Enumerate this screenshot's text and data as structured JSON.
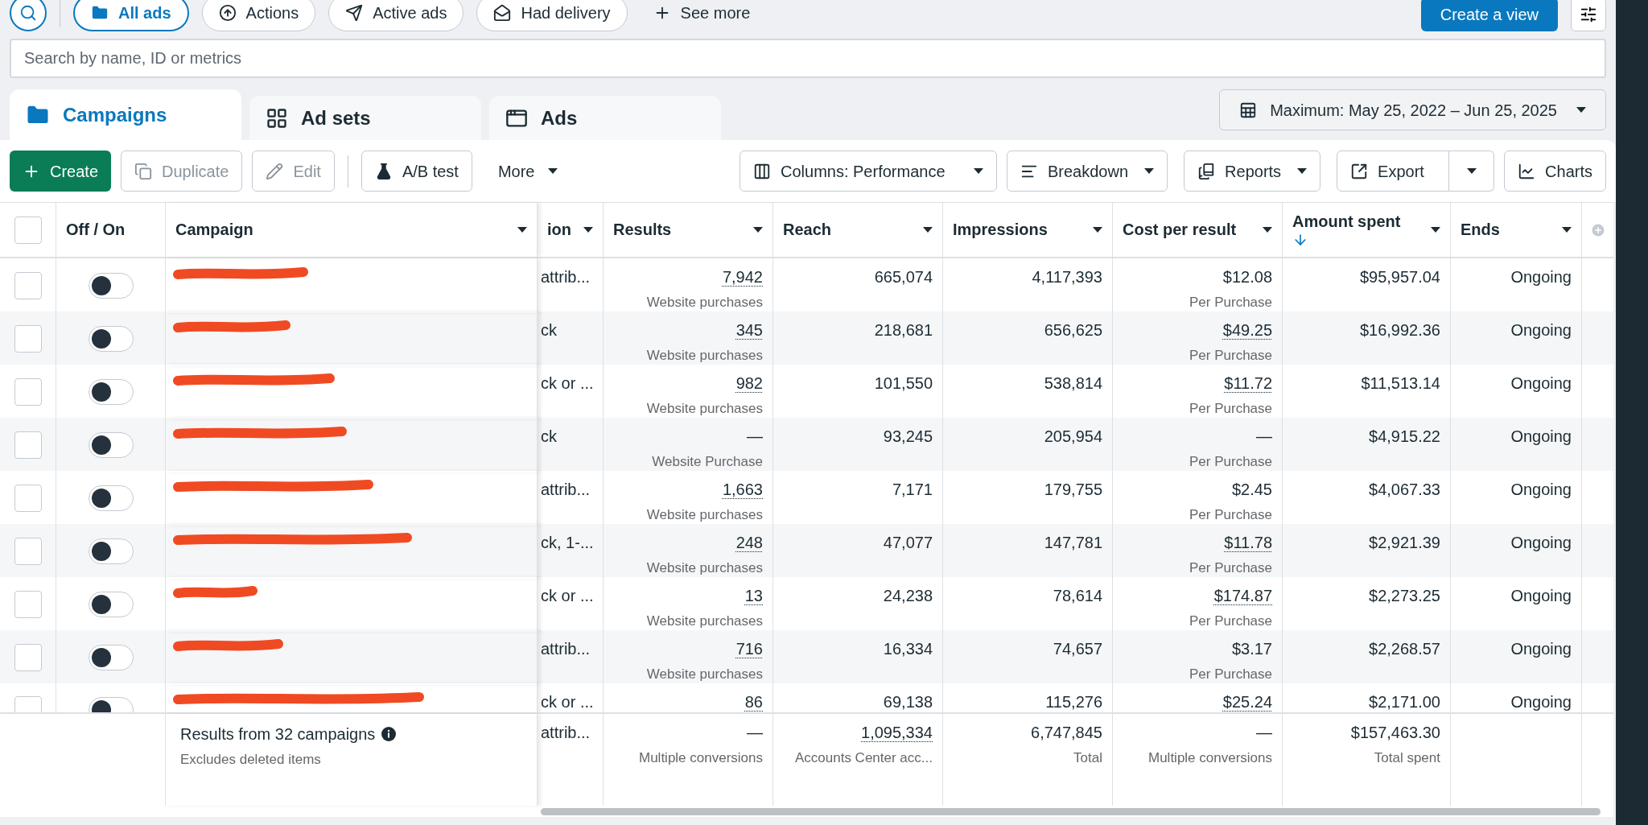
{
  "filters": [
    {
      "label": "All ads",
      "selected": true,
      "kind": "folder"
    },
    {
      "label": "Actions",
      "selected": false,
      "kind": "actions"
    },
    {
      "label": "Active ads",
      "selected": false,
      "kind": "send"
    },
    {
      "label": "Had delivery",
      "selected": false,
      "kind": "mail"
    }
  ],
  "see_more": "See more",
  "create_view": "Create a view",
  "search": {
    "placeholder": "Search by name, ID or metrics"
  },
  "tabs": [
    {
      "label": "Campaigns",
      "selected": true,
      "kind": "campaigns"
    },
    {
      "label": "Ad sets",
      "selected": false,
      "kind": "adsets"
    },
    {
      "label": "Ads",
      "selected": false,
      "kind": "ads"
    }
  ],
  "date_range": "Maximum: May 25, 2022 – Jun 25, 2025",
  "toolbar": {
    "create": "Create",
    "duplicate": {
      "label": "Duplicate",
      "disabled": true
    },
    "edit": {
      "label": "Edit",
      "disabled": true
    },
    "ab_test": "A/B test",
    "more": "More",
    "columns": "Columns: Performance",
    "breakdown": "Breakdown",
    "reports": "Reports",
    "export": "Export",
    "charts": "Charts"
  },
  "table": {
    "select_all_checked": false,
    "columns": [
      "Off / On",
      "Campaign",
      "ion",
      "Results",
      "Reach",
      "Impressions",
      "Cost per result",
      "Amount spent",
      "Ends"
    ],
    "rows": [
      {
        "checked": false,
        "on": false,
        "column_4": "attrib...",
        "results": "7,942",
        "results_note": "Website purchases",
        "reach": "665,074",
        "impressions": "4,117,393",
        "cost": "$12.08",
        "cost_dotted": false,
        "cost_note": "Per Purchase",
        "spent": "$95,957.04",
        "ends": "Ongoing"
      },
      {
        "checked": false,
        "on": false,
        "column_4": "ck",
        "results": "345",
        "results_note": "Website purchases",
        "reach": "218,681",
        "impressions": "656,625",
        "cost": "$49.25",
        "cost_dotted": true,
        "cost_note": "Per Purchase",
        "spent": "$16,992.36",
        "ends": "Ongoing"
      },
      {
        "checked": false,
        "on": false,
        "column_4": "ck or ...",
        "results": "982",
        "results_note": "Website purchases",
        "reach": "101,550",
        "impressions": "538,814",
        "cost": "$11.72",
        "cost_dotted": true,
        "cost_note": "Per Purchase",
        "spent": "$11,513.14",
        "ends": "Ongoing"
      },
      {
        "checked": false,
        "on": false,
        "column_4": "ck",
        "results": "—",
        "results_note": "Website Purchase",
        "reach": "93,245",
        "impressions": "205,954",
        "cost": "—",
        "cost_dotted": false,
        "cost_note": "Per Purchase",
        "spent": "$4,915.22",
        "ends": "Ongoing"
      },
      {
        "checked": false,
        "on": false,
        "column_4": "attrib...",
        "results": "1,663",
        "results_note": "Website purchases",
        "reach": "7,171",
        "impressions": "179,755",
        "cost": "$2.45",
        "cost_dotted": false,
        "cost_note": "Per Purchase",
        "spent": "$4,067.33",
        "ends": "Ongoing"
      },
      {
        "checked": false,
        "on": false,
        "column_4": "ck, 1-...",
        "results": "248",
        "results_note": "Website purchases",
        "reach": "47,077",
        "impressions": "147,781",
        "cost": "$11.78",
        "cost_dotted": true,
        "cost_note": "Per Purchase",
        "spent": "$2,921.39",
        "ends": "Ongoing"
      },
      {
        "checked": false,
        "on": false,
        "column_4": "ck or ...",
        "results": "13",
        "results_note": "Website purchases",
        "reach": "24,238",
        "impressions": "78,614",
        "cost": "$174.87",
        "cost_dotted": true,
        "cost_note": "Per Purchase",
        "spent": "$2,273.25",
        "ends": "Ongoing"
      },
      {
        "checked": false,
        "on": false,
        "column_4": "attrib...",
        "results": "716",
        "results_note": "Website purchases",
        "reach": "16,334",
        "impressions": "74,657",
        "cost": "$3.17",
        "cost_dotted": false,
        "cost_note": "Per Purchase",
        "spent": "$2,268.57",
        "ends": "Ongoing"
      },
      {
        "checked": false,
        "on": false,
        "column_4": "ck or ...",
        "results": "86",
        "reach": "69,138",
        "impressions": "115,276",
        "cost": "$25.24",
        "cost_dotted": true,
        "spent": "$2,171.00",
        "ends": "Ongoing"
      }
    ],
    "summary": {
      "title": "Results from 32 campaigns",
      "note": "Excludes deleted items",
      "column_4": "attrib...",
      "results": "—",
      "results_note": "Multiple conversions",
      "reach": "1,095,334",
      "reach_note": "Accounts Center acc...",
      "impressions": "6,747,845",
      "impressions_note": "Total",
      "cost": "—",
      "cost_note": "Multiple conversions",
      "spent": "$157,463.30",
      "spent_note": "Total spent"
    }
  }
}
